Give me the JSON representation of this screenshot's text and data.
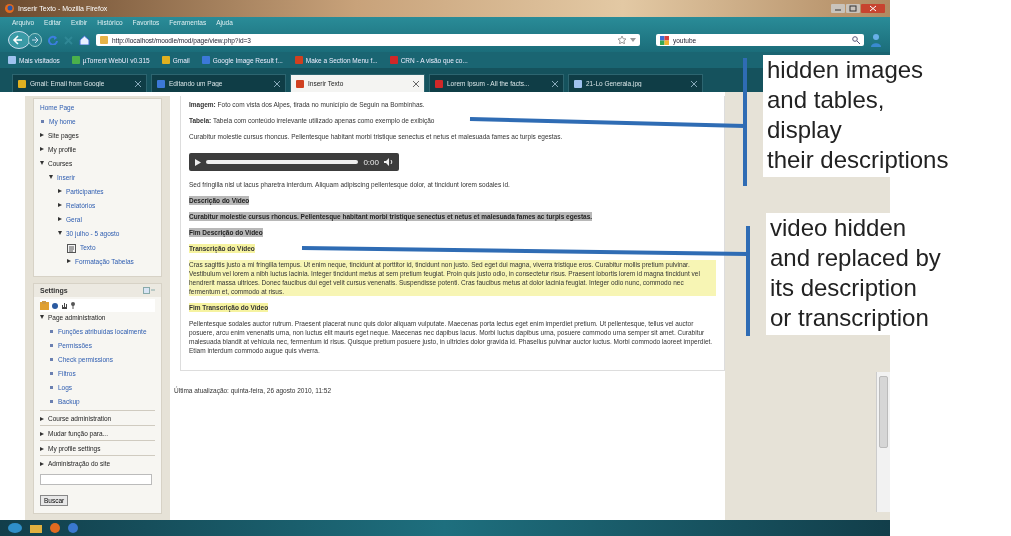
{
  "window": {
    "title": "Inserir Texto - Mozilla Firefox"
  },
  "menu": [
    "Arquivo",
    "Editar",
    "Exibir",
    "Histórico",
    "Favoritos",
    "Ferramentas",
    "Ajuda"
  ],
  "address": {
    "value": "http://localhost/moodle/mod/page/view.php?id=3"
  },
  "search": {
    "value": "youtube"
  },
  "bookmarks": [
    "Mais visitados",
    "µTorrent WebUI v0.315",
    "Gmail",
    "Google Image Result f...",
    "Make a Section Menu f...",
    "CRN - A visão que co..."
  ],
  "tabs": [
    {
      "label": "Gmail: Email from Google",
      "selected": false
    },
    {
      "label": "Editando um Page",
      "selected": false
    },
    {
      "label": "Inserir Texto",
      "selected": true
    },
    {
      "label": "Lorem Ipsum - All the facts...",
      "selected": false
    },
    {
      "label": "21-Lo Generala.jpg",
      "selected": false
    }
  ],
  "navigation": {
    "items": [
      {
        "kind": "heading",
        "label": "Home Page"
      },
      {
        "kind": "leaf",
        "label": "My home"
      },
      {
        "kind": "branch",
        "label": "Site pages",
        "expanded": false
      },
      {
        "kind": "branch",
        "label": "My profile",
        "expanded": false
      },
      {
        "kind": "branch",
        "label": "Courses",
        "expanded": true,
        "children": [
          {
            "kind": "branch",
            "label": "Inserir",
            "expanded": true,
            "children": [
              {
                "kind": "branch",
                "label": "Participantes",
                "expanded": false
              },
              {
                "kind": "branch",
                "label": "Relatórios",
                "expanded": false
              },
              {
                "kind": "branch",
                "label": "Geral",
                "expanded": false
              },
              {
                "kind": "branch",
                "label": "30 julho - 5 agosto",
                "expanded": true,
                "children": [
                  {
                    "kind": "page",
                    "label": "Texto"
                  },
                  {
                    "kind": "branch",
                    "label": "Formatação Tabelas",
                    "expanded": false
                  }
                ]
              }
            ]
          }
        ]
      }
    ]
  },
  "settings": {
    "title": "Settings",
    "items": [
      {
        "kind": "branch",
        "label": "Page administration",
        "expanded": true,
        "children": [
          {
            "kind": "leaf",
            "label": "Funções atribuídas localmente"
          },
          {
            "kind": "leaf",
            "label": "Permissões"
          },
          {
            "kind": "leaf",
            "label": "Check permissions"
          },
          {
            "kind": "leaf",
            "label": "Filtros"
          },
          {
            "kind": "leaf",
            "label": "Logs"
          },
          {
            "kind": "leaf",
            "label": "Backup"
          }
        ]
      }
    ],
    "sections": [
      {
        "label": "Course administration",
        "expanded": false
      },
      {
        "label": "Mudar função para...",
        "expanded": false
      },
      {
        "label": "My profile settings",
        "expanded": false
      },
      {
        "label": "Administração do site",
        "expanded": false
      }
    ],
    "search_button": "Buscar"
  },
  "content": {
    "blocks": [
      {
        "kind": "text",
        "text": "**Imagem:** Foto com vista dos Alpes, tirada no município de Seguin na Bombinhas."
      },
      {
        "kind": "text",
        "text": "**Tabela:** Tabela com conteúdo irrelevante utilizado apenas como exemplo de exibição"
      },
      {
        "kind": "text",
        "text": "Curabitur molestie cursus rhoncus. Pellentesque habitant morbi tristique senectus et netus et malesuada fames ac turpis egestas."
      },
      {
        "kind": "player",
        "time": "0:00"
      },
      {
        "kind": "text",
        "text": "Sed fringilla nisl ut lacus pharetra interdum. Aliquam adipiscing pellentesque dolor, at tincidunt lorem sodales id."
      },
      {
        "kind": "description",
        "text": "Descrição do Vídeo"
      },
      {
        "kind": "description",
        "text": "Curabitur molestie cursus rhoncus. Pellentesque habitant morbi tristique senectus et netus et malesuada fames ac turpis egestas."
      },
      {
        "kind": "description",
        "text": "Fim Descrição do Vídeo"
      },
      {
        "kind": "transcript_title",
        "text": "Transcrição do Vídeo"
      },
      {
        "kind": "transcript",
        "text": "Cras sagittis justo a mi fringilla tempus. Ut enim neque, tincidunt at porttitor id, tincidunt non justo. Sed eget dui magna, viverra tristique eros. Curabitur mollis pretium pulvinar. Vestibulum vel lorem a nibh luctus lacinia. Integer tincidunt metus at sem pretium feugiat. Proin quis justo odio, in consectetur risus. Praesent lobortis lorem id magna tincidunt vel hendrerit massa ultrices. Donec faucibus dui eget velit cursus venenatis. Suspendisse potenti. Cras faucibus metus at dolor lacinia feugiat. Integer odio nunc, commodo nec fermentum et, commodo at risus."
      },
      {
        "kind": "transcript_title",
        "text": "Fim Transcrição do Vídeo"
      },
      {
        "kind": "text",
        "text": "Pellentesque sodales auctor rutrum. Praesent placerat nunc quis dolor aliquam vulputate. Maecenas porta lectus eget enim imperdiet pretium. Ut pellentesque, tellus vel auctor posuere, arcu enim venenatis urna, non luctus elit mauris eget neque. Maecenas nec dapibus lacus. Morbi luctus dapibus urna, posuere commodo urna semper sit amet. Curabitur malesuada blandit at vehicula nec, fermentum id risus. Quisque pretium posuere justo, in ultricies dolor gravida id. Phasellus pulvinar auctor luctus. Morbi commodo laoreet imperdiet. Etiam interdum commodo augue quis viverra."
      }
    ],
    "last_modified": "Última atualização: quinta-feira, 26 agosto 2010, 11:52"
  },
  "notes": [
    {
      "text": "hidden images\nand tables,\ndisplay\ntheir descriptions"
    },
    {
      "text": "video hidden\nand replaced by\nits description\nor transcription"
    }
  ]
}
